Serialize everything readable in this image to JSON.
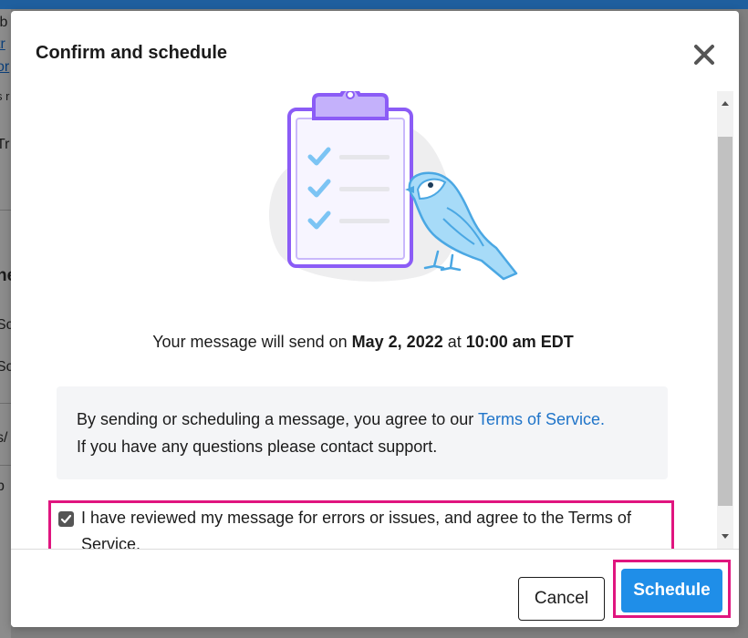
{
  "background_page": {
    "fragments": [
      "ib",
      "tr",
      "or",
      "s r",
      "Tr",
      "he",
      "Sc",
      "Sc",
      "s/",
      "p"
    ]
  },
  "modal": {
    "title": "Confirm and schedule",
    "close_icon": "close-icon",
    "send_info": {
      "prefix": "Your message will send on ",
      "date": "May 2, 2022",
      "middle": " at ",
      "time": "10:00 am EDT"
    },
    "terms_notice": {
      "line1_prefix": "By sending or scheduling a message, you agree to our ",
      "link_text": "Terms of Service.",
      "line2": "If you have any questions please contact support."
    },
    "agreement": {
      "checked": true,
      "label": "I have reviewed my message for errors or issues, and agree to the Terms of Service."
    },
    "buttons": {
      "cancel": "Cancel",
      "schedule": "Schedule"
    }
  },
  "colors": {
    "accent": "#1f8ee8",
    "link": "#1f74c9",
    "highlight": "#e0157f",
    "illustration_purple": "#8b5cf6",
    "illustration_blue": "#7cc4f4"
  }
}
